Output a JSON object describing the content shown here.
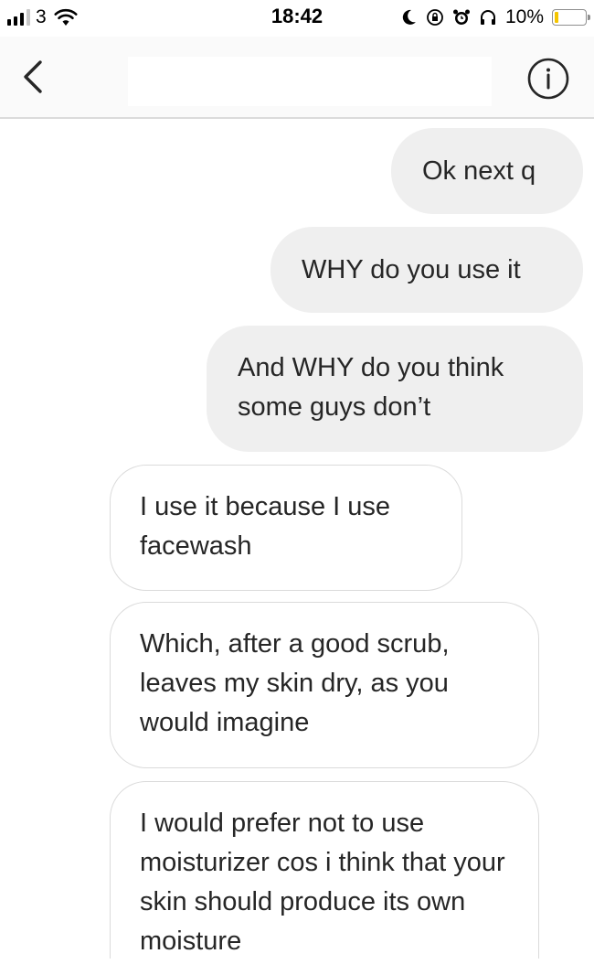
{
  "status_bar": {
    "carrier": "3",
    "time": "18:42",
    "battery_percent": "10%",
    "icons": [
      "signal-icon",
      "wifi-icon",
      "moon-icon",
      "screen-lock-icon",
      "alarm-icon",
      "headphones-icon",
      "battery-icon"
    ],
    "battery_color": "#f5c500"
  },
  "header": {
    "back_icon": "chevron-left-icon",
    "title": "",
    "info_icon": "info-circle-icon"
  },
  "messages": [
    {
      "direction": "outgoing",
      "text": "Ok next q"
    },
    {
      "direction": "outgoing",
      "text": "WHY do you use it"
    },
    {
      "direction": "outgoing",
      "text": "And WHY do you think some guys don’t"
    },
    {
      "direction": "incoming",
      "text": "I use it because I use facewash"
    },
    {
      "direction": "incoming",
      "text": "Which, after a good scrub, leaves my skin dry, as you would imagine"
    },
    {
      "direction": "incoming",
      "text": "I would prefer not to use moisturizer cos i think that your skin should produce its own moisture"
    }
  ],
  "colors": {
    "outgoing_bubble": "#efefef",
    "incoming_border": "#dbdbdb",
    "text": "#262626"
  }
}
